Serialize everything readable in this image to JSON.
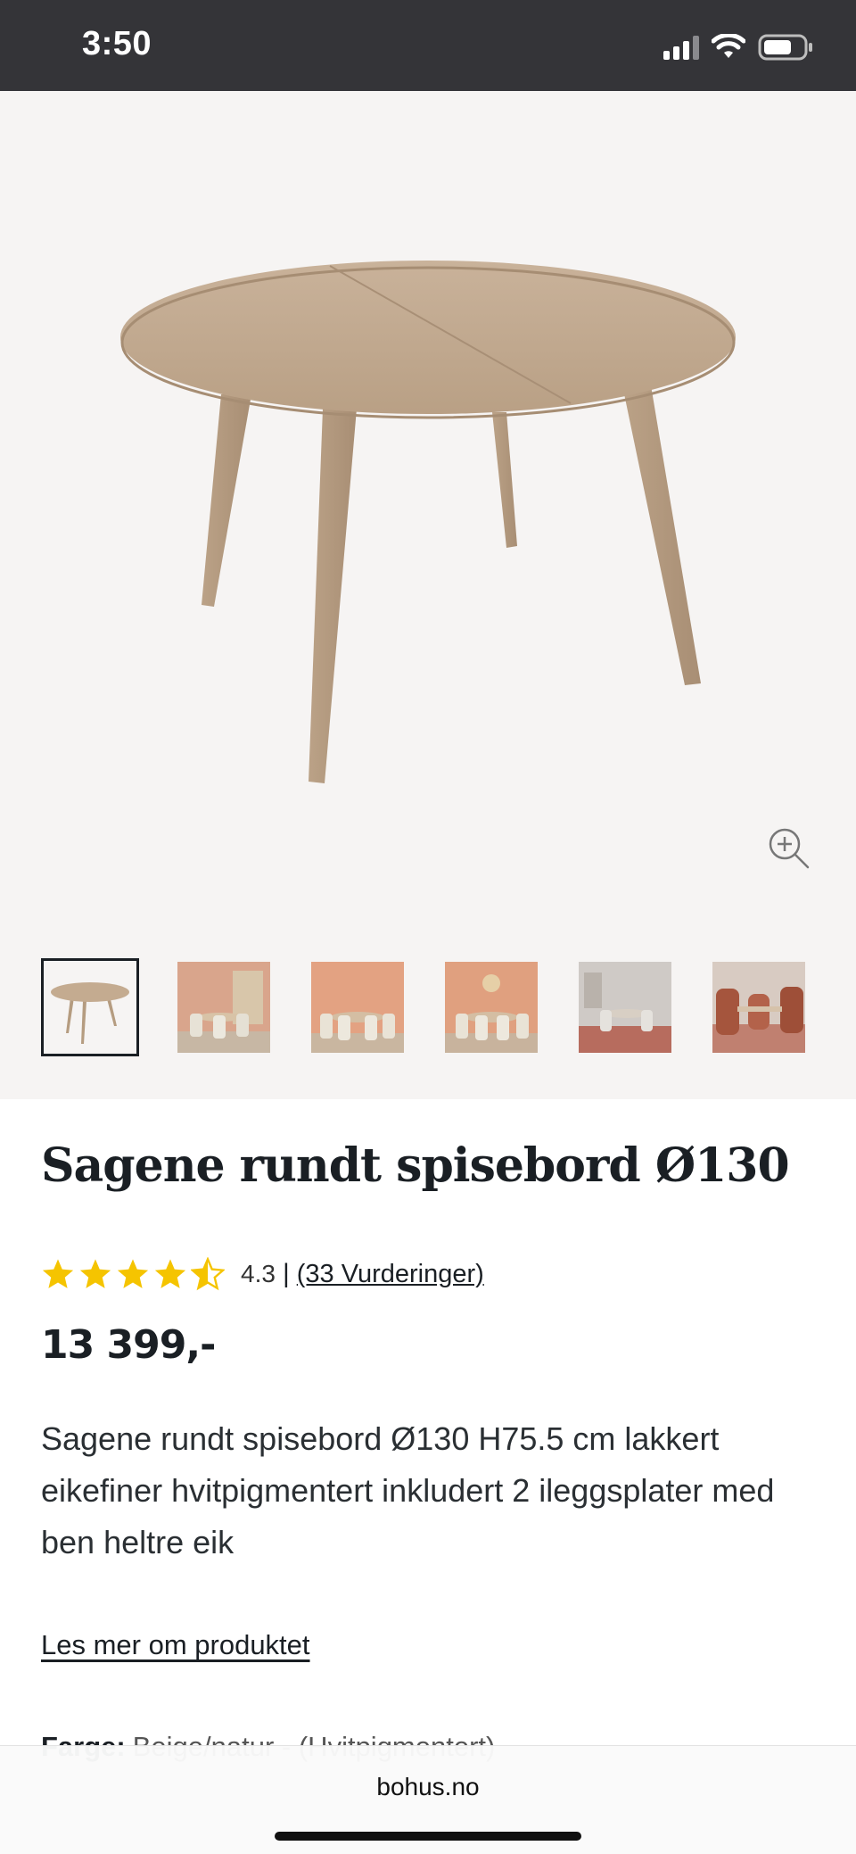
{
  "status_bar": {
    "time": "3:50"
  },
  "gallery": {
    "hero_icon": "table-image",
    "zoom_icon": "zoom-in-icon",
    "thumbnails": [
      {
        "kind": "product",
        "active": true
      },
      {
        "kind": "room-beige"
      },
      {
        "kind": "room-terracotta"
      },
      {
        "kind": "room-terracotta-flowers"
      },
      {
        "kind": "room-grey"
      },
      {
        "kind": "room-chairs-rust"
      }
    ]
  },
  "product": {
    "title": "Sagene rundt spisebord Ø130",
    "rating": {
      "value": "4.3",
      "score": 4.3,
      "max": 5,
      "separator": "|",
      "reviews_link": "(33 Vurderinger)"
    },
    "price": "13 399,-",
    "description": "Sagene rundt spisebord Ø130 H75.5 cm lakkert eikefiner hvitpigmentert inkludert 2 ileggsplater med ben heltre eik",
    "read_more": "Les mer om produktet",
    "color_label": "Farge:",
    "color_value": "Beige/natur - (Hvitpigmentert)"
  },
  "browser": {
    "url": "bohus.no"
  },
  "colors": {
    "status_bar_bg": "#343438",
    "gallery_bg": "#f6f4f3",
    "star": "#f5c400",
    "text": "#1a1f24",
    "wood": "#c5ad92"
  }
}
